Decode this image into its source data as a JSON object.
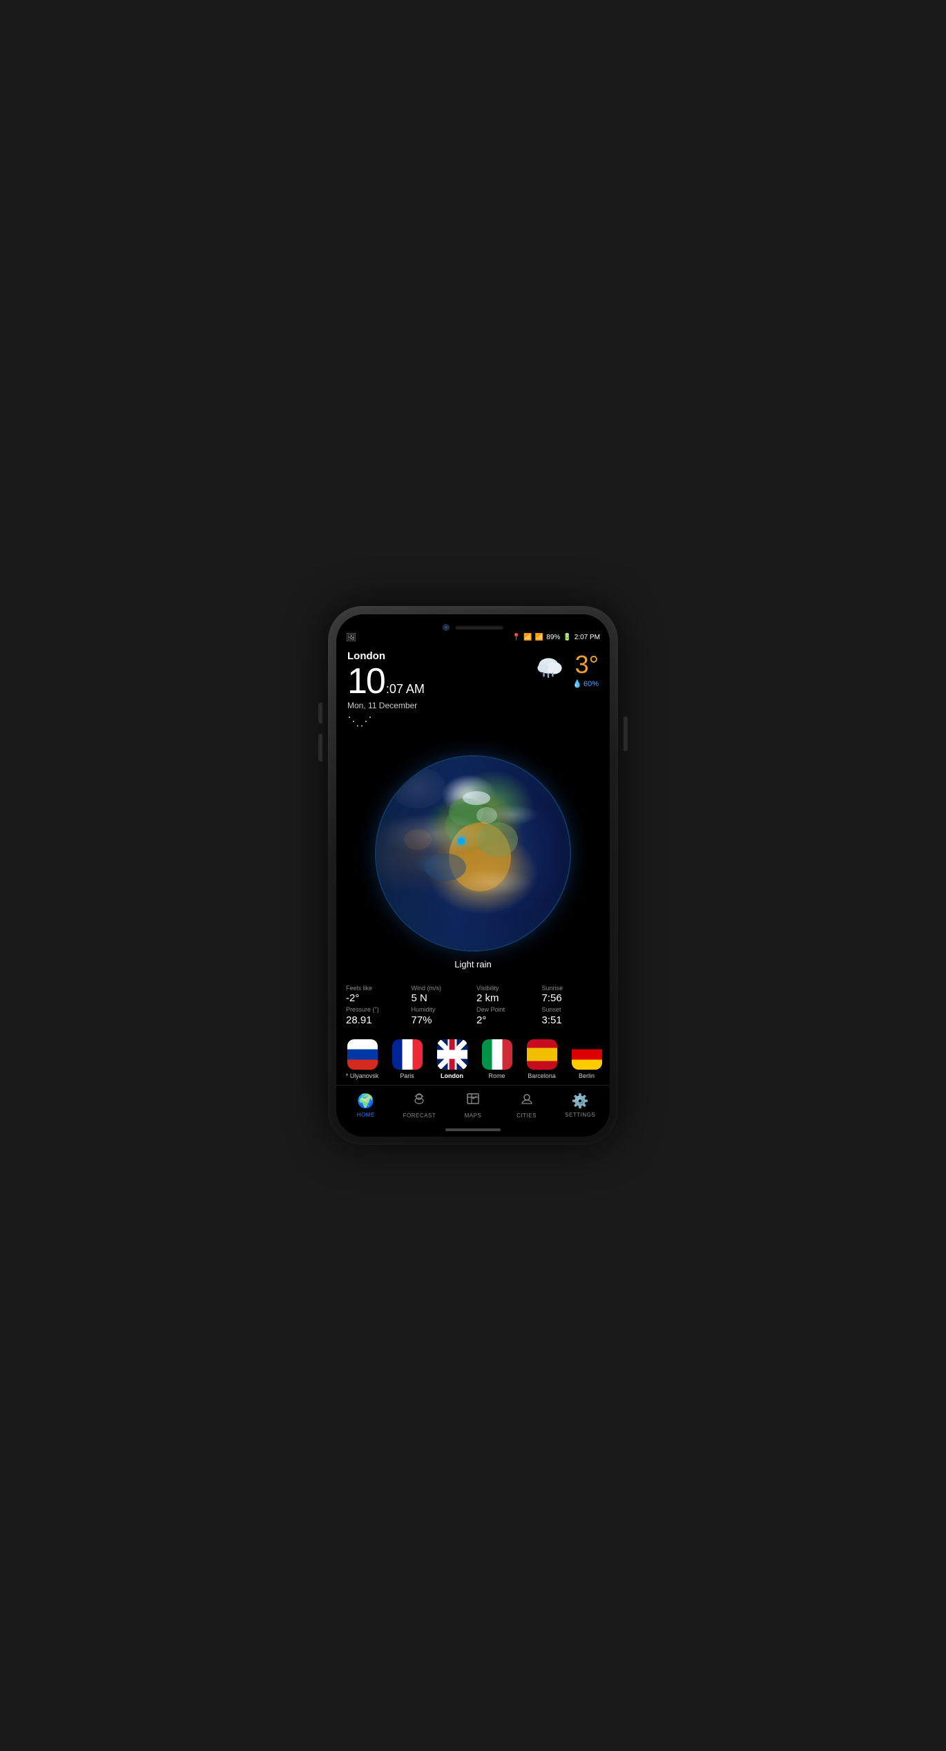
{
  "phone": {
    "status_bar": {
      "location_icon": "📍",
      "wifi_icon": "wifi",
      "signal_bars": "signal",
      "battery": "89%",
      "time": "2:07 PM"
    },
    "app": {
      "city": "London",
      "time_big": "10",
      "time_small": ":07 AM",
      "date": "Mon, 11 December",
      "weather": {
        "condition": "Light rain",
        "temperature": "3°",
        "precipitation_pct": "60%",
        "feels_like_label": "Feels like",
        "feels_like": "-2°",
        "wind_label": "Wind (m/s)",
        "wind": "5 N",
        "visibility_label": "Visibility",
        "visibility": "2 km",
        "sunrise_label": "Sunrise",
        "sunrise": "7:56",
        "pressure_label": "Pressure (\")",
        "pressure": "28.91",
        "humidity_label": "Humidity",
        "humidity": "77%",
        "dew_point_label": "Dew Point",
        "dew_point": "2°",
        "sunset_label": "Sunset",
        "sunset": "3:51"
      },
      "cities": [
        {
          "name": "* Ulyanovsk",
          "flag": "russia",
          "active": false
        },
        {
          "name": "Paris",
          "flag": "france",
          "active": false
        },
        {
          "name": "London",
          "flag": "uk",
          "active": true
        },
        {
          "name": "Rome",
          "flag": "italy",
          "active": false
        },
        {
          "name": "Barcelona",
          "flag": "spain",
          "active": false
        },
        {
          "name": "Berlin",
          "flag": "germany",
          "active": false
        }
      ],
      "nav": [
        {
          "id": "home",
          "label": "HOME",
          "active": true
        },
        {
          "id": "forecast",
          "label": "FORECAST",
          "active": false
        },
        {
          "id": "maps",
          "label": "MAPS",
          "active": false
        },
        {
          "id": "cities",
          "label": "CITIES",
          "active": false
        },
        {
          "id": "settings",
          "label": "SETTINGS",
          "active": false
        }
      ]
    }
  }
}
